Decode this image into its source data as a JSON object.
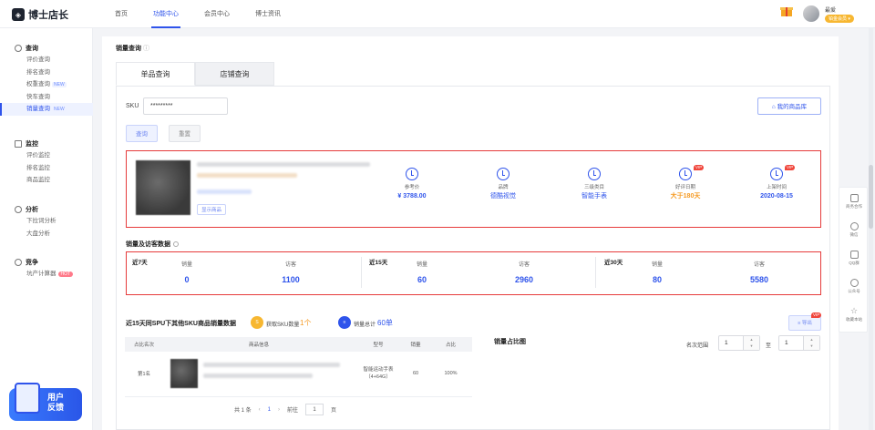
{
  "header": {
    "logo_mark": "◈",
    "logo_text": "博士店长",
    "nav": [
      "首页",
      "功能中心",
      "会员中心",
      "博士资讯"
    ],
    "active_nav": "功能中心",
    "user_name": "最爱",
    "user_badge": "铂金会员 ▾"
  },
  "sidebar": {
    "groups": [
      {
        "title": "查询",
        "icon": "search-icon",
        "items": [
          {
            "label": "评价查询",
            "tag": ""
          },
          {
            "label": "排名查询",
            "tag": ""
          },
          {
            "label": "权重查询",
            "tag": "NEW"
          },
          {
            "label": "快车查询",
            "tag": ""
          },
          {
            "label": "销量查询",
            "tag": "NEW",
            "active": true
          }
        ]
      },
      {
        "title": "监控",
        "icon": "monitor-icon",
        "items": [
          {
            "label": "评价监控",
            "tag": ""
          },
          {
            "label": "排名监控",
            "tag": ""
          },
          {
            "label": "商品监控",
            "tag": ""
          }
        ]
      },
      {
        "title": "分析",
        "icon": "analysis-icon",
        "items": [
          {
            "label": "下拉词分析",
            "tag": ""
          },
          {
            "label": "大盘分析",
            "tag": ""
          }
        ]
      },
      {
        "title": "竞争",
        "icon": "compete-icon",
        "items": [
          {
            "label": "坑产计算器",
            "tag": "HOT"
          }
        ]
      }
    ],
    "feedback_line1": "用户",
    "feedback_line2": "反馈"
  },
  "page": {
    "title": "销量查询",
    "tabs": [
      "单品查询",
      "店铺查询"
    ],
    "sku_label": "SKU",
    "sku_value": "*********",
    "query_button": "查询",
    "reset_button": "重置",
    "my_products_button": "我的商品库",
    "show_product": "显示商品"
  },
  "product_info": [
    {
      "key": "参考价",
      "value": "¥ 3788.00",
      "style": "bold",
      "vip": false
    },
    {
      "key": "品牌",
      "value": "德酷视觉",
      "style": "link",
      "vip": false
    },
    {
      "key": "三级类目",
      "value": "智能手表",
      "style": "link",
      "vip": false
    },
    {
      "key": "好评日期",
      "value": "大于180天",
      "style": "orange",
      "vip": true
    },
    {
      "key": "上架时间",
      "value": "2020-08-15",
      "style": "bold",
      "vip": true
    }
  ],
  "vip_label": "VIP",
  "sales_section_title": "销量及访客数据",
  "periods": [
    {
      "title": "近7天",
      "sales_label": "销量",
      "sales": "0",
      "visits_label": "访客",
      "visits": "1100"
    },
    {
      "title": "近15天",
      "sales_label": "销量",
      "sales": "60",
      "visits_label": "访客",
      "visits": "2960"
    },
    {
      "title": "近30天",
      "sales_label": "销量",
      "sales": "80",
      "visits_label": "访客",
      "visits": "5580"
    }
  ],
  "spu": {
    "title": "近15天同SPU下其他SKU商品销量数据",
    "sku_count_label": "获取SKU数量",
    "sku_count_value": "1个",
    "sales_total_label": "销量总计",
    "sales_total_value": "60单",
    "export_button": "≡ 导出",
    "columns": [
      "占比名次",
      "商品信息",
      "型号",
      "销量",
      "占比"
    ],
    "rows": [
      {
        "rank": "第1名",
        "model": "智能运动手表（4+64G）",
        "sales": "60",
        "share": "100%"
      }
    ],
    "pager_total": "共 1 条",
    "pager_page": "1",
    "pager_goto": "前往",
    "pager_goto_value": "1",
    "pager_unit": "页",
    "pager_prev": "‹",
    "pager_next": "›"
  },
  "share_chart": {
    "title": "销量占比图",
    "range_label": "名次范围",
    "range_from": "1",
    "range_to_label": "至",
    "range_to": "1"
  },
  "rightbar": [
    "商务合作",
    "微信",
    "QQ群",
    "公众号",
    "收藏本站"
  ],
  "colors": {
    "accent": "#2f54eb",
    "highlight": "#e63b3b",
    "orange": "#f59a23"
  }
}
